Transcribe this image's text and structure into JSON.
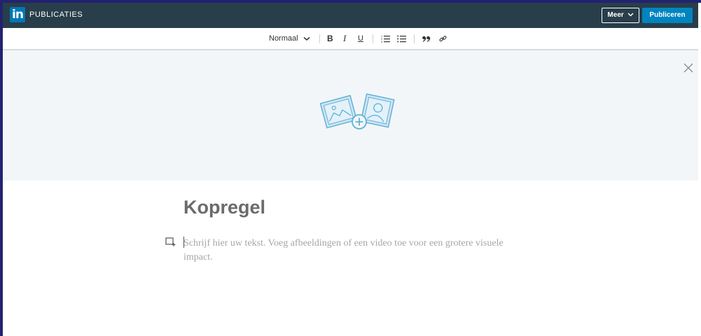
{
  "header": {
    "logo_text": "in",
    "brand": "PUBLICATIES",
    "more_label": "Meer",
    "publish_label": "Publiceren"
  },
  "toolbar": {
    "style_select": "Normaal",
    "bold": "B",
    "italic": "I",
    "underline": "U"
  },
  "editor": {
    "headline_placeholder": "Kopregel",
    "body_placeholder": "Schrijf hier uw tekst. Voeg afbeeldingen of een video toe voor een grotere visuele impact."
  },
  "icons": [
    "linkedin-logo-icon",
    "chevron-down-icon",
    "ordered-list-icon",
    "bullet-list-icon",
    "quote-icon",
    "link-icon",
    "close-icon",
    "add-image-icon",
    "add-media-icon"
  ],
  "colors": {
    "topbar": "#283e4a",
    "accent": "#0084bf",
    "cover_bg": "#f3f6f8"
  }
}
